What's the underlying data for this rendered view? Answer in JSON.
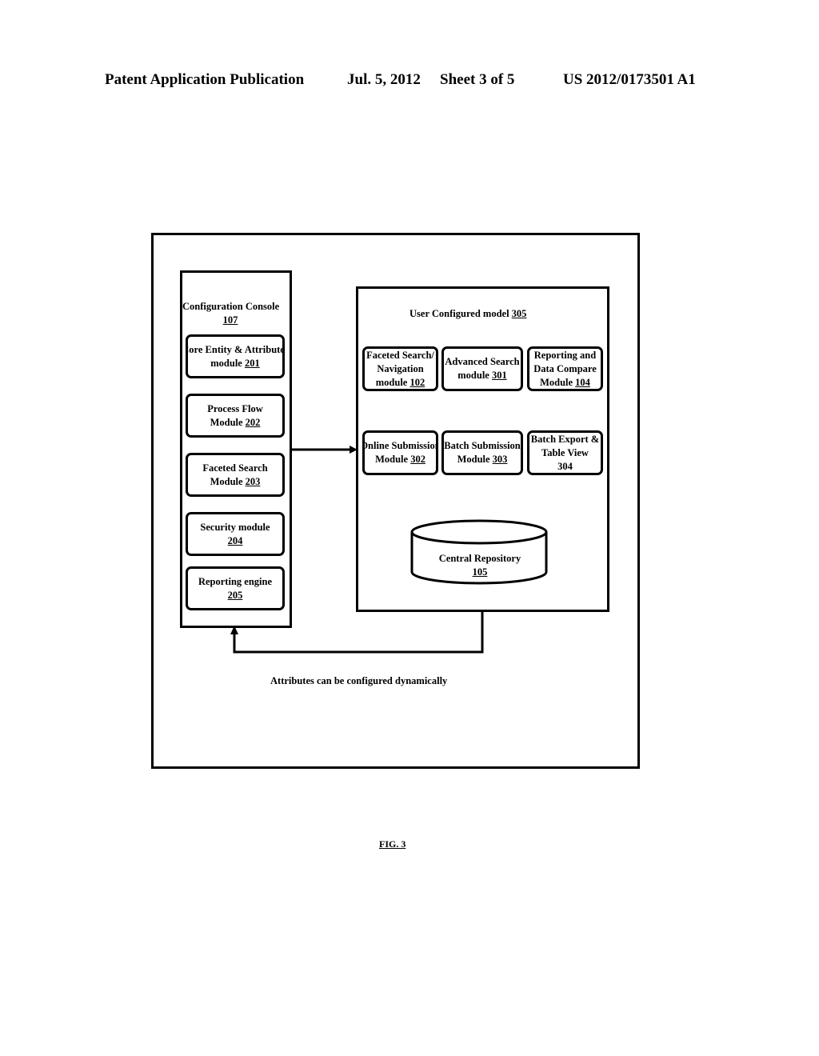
{
  "header": {
    "publication": "Patent Application Publication",
    "date": "Jul. 5, 2012",
    "sheet": "Sheet 3 of 5",
    "number": "US 2012/0173501 A1"
  },
  "configuration_console": {
    "title": "Configuration Console",
    "ref": "107",
    "modules": [
      {
        "line1": "Core Entity & Attributes",
        "line2_text": "module ",
        "ref": "201"
      },
      {
        "line1": "Process Flow",
        "line2_text": "Module ",
        "ref": "202"
      },
      {
        "line1": "Faceted Search",
        "line2_text": "Module ",
        "ref": "203"
      },
      {
        "line1": "Security module",
        "line2_text": "",
        "ref": "204"
      },
      {
        "line1": "Reporting engine",
        "line2_text": "",
        "ref": "205"
      }
    ]
  },
  "user_configured_model": {
    "title": "User Configured model ",
    "ref": "305",
    "modules": [
      {
        "line1": "Faceted Search/",
        "line2": "Navigation",
        "line3_text": "module ",
        "ref": "102"
      },
      {
        "line1": "Advanced Search",
        "line2": "",
        "line3_text": "module ",
        "ref": "301"
      },
      {
        "line1": "Reporting and",
        "line2": "Data Compare",
        "line3_text": "Module ",
        "ref": "104"
      },
      {
        "line1": "Online Submission",
        "line2": "",
        "line3_text": "Module ",
        "ref": "302"
      },
      {
        "line1": "Batch Submission",
        "line2": "",
        "line3_text": "Module ",
        "ref": "303"
      },
      {
        "line1": "Batch Export &",
        "line2": "Table View",
        "line3_text": "",
        "ref": "304"
      }
    ],
    "repository": {
      "label": "Central Repository",
      "ref": "105"
    }
  },
  "feedback_caption": "Attributes can be configured dynamically",
  "figure_label": "FIG. 3"
}
